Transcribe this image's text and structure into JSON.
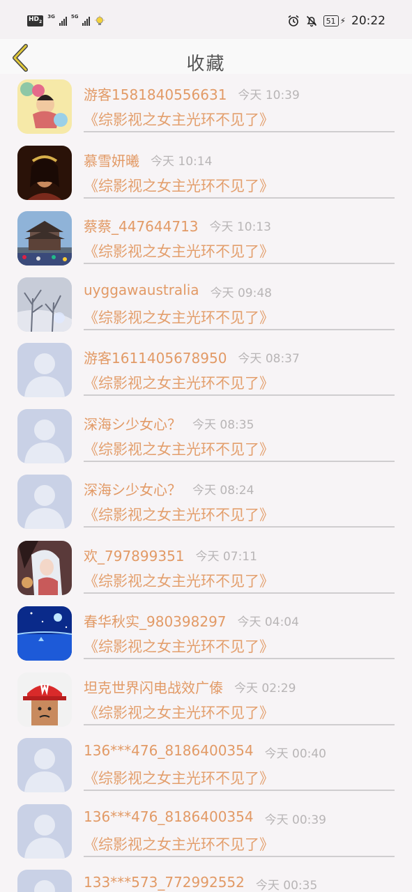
{
  "status_bar": {
    "hd": "HD",
    "hd_sub": "2",
    "net1": "3G",
    "net2": "5G",
    "battery": "51",
    "time": "20:22"
  },
  "header": {
    "title": "收藏"
  },
  "book_title": "《综影视之女主光环不见了》",
  "items": [
    {
      "name": "游客1581840556631",
      "time": "今天 10:39",
      "avatar": "cartoon-doll-avatar"
    },
    {
      "name": "慕雪妍曦",
      "time": "今天 10:14",
      "avatar": "woman-portrait-avatar"
    },
    {
      "name": "蔡蔡_447644713",
      "time": "今天 10:13",
      "avatar": "temple-photo-avatar"
    },
    {
      "name": "uyggawaustralia",
      "time": "今天 09:48",
      "avatar": "snowy-tree-avatar"
    },
    {
      "name": "游客1611405678950",
      "time": "今天 08:37",
      "avatar": "default-avatar"
    },
    {
      "name": "深海シ少女心？",
      "time": "今天 08:35",
      "avatar": "default-avatar"
    },
    {
      "name": "深海シ少女心？",
      "time": "今天 08:24",
      "avatar": "default-avatar"
    },
    {
      "name": "欢_797899351",
      "time": "今天 07:11",
      "avatar": "anime-girl-avatar"
    },
    {
      "name": "春华秋实_980398297",
      "time": "今天 04:04",
      "avatar": "blue-night-avatar"
    },
    {
      "name": "坦克世界闪电战效广傣",
      "time": "今天 02:29",
      "avatar": "red-cap-avatar"
    },
    {
      "name": "136***476_8186400354",
      "time": "今天 00:40",
      "avatar": "default-avatar"
    },
    {
      "name": "136***476_8186400354",
      "time": "今天 00:39",
      "avatar": "default-avatar"
    },
    {
      "name": "133***573_772992552",
      "time": "今天 00:35",
      "avatar": "default-avatar"
    }
  ],
  "colors": {
    "name": "#e29a66",
    "time": "#b8b5b6",
    "book": "#e39f6d",
    "back_arrow": "#e0c93a"
  }
}
